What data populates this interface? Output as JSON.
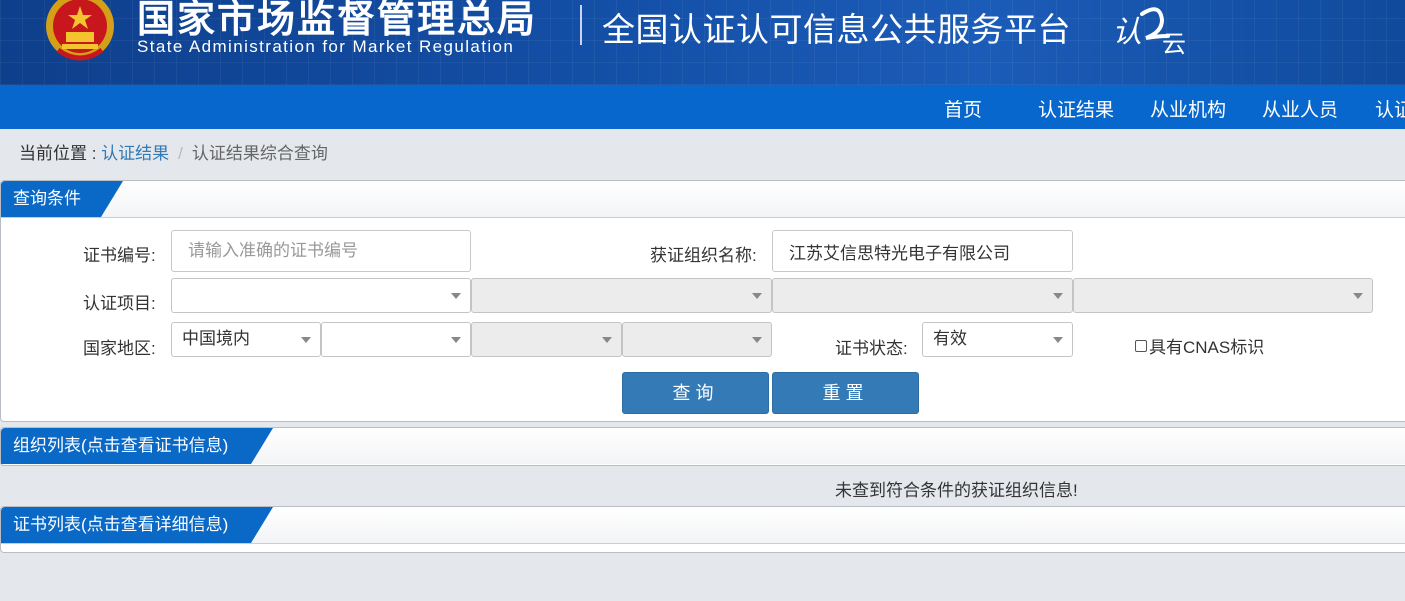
{
  "header": {
    "agency_cn": "国家市场监督管理总局",
    "agency_en": "State Administration  for  Market Regulation",
    "platform_title": "全国认证认可信息公共服务平台",
    "logo_text_1": "认",
    "logo_text_2": "云"
  },
  "nav": {
    "items": [
      "首页",
      "认证结果",
      "从业机构",
      "从业人员",
      "认证"
    ]
  },
  "breadcrumb": {
    "prefix": "当前位置 : ",
    "link": "认证结果",
    "separator": "/",
    "current": "认证结果综合查询"
  },
  "query_panel": {
    "title": "查询条件",
    "cert_no": {
      "label": "证书编号:",
      "placeholder": "请输入准确的证书编号",
      "value": ""
    },
    "org_name": {
      "label": "获证组织名称:",
      "value": "江苏艾信思特光电子有限公司"
    },
    "cert_project": {
      "label": "认证项目:",
      "selects": [
        "",
        "",
        "",
        ""
      ]
    },
    "region": {
      "label": "国家地区:",
      "selects": [
        "中国境内",
        "",
        "",
        ""
      ]
    },
    "cert_status": {
      "label": "证书状态:",
      "value": "有效"
    },
    "cnas": {
      "label": "具有CNAS标识",
      "checked": false
    },
    "buttons": {
      "search": "查询",
      "reset": "重置"
    }
  },
  "org_panel": {
    "title": "组织列表(点击查看证书信息)",
    "empty_message": "未查到符合条件的获证组织信息!"
  },
  "cert_panel": {
    "title": "证书列表(点击查看详细信息)"
  },
  "colors": {
    "banner": "#1450a8",
    "navbar": "#0867cc",
    "tab": "#0a69c6",
    "button": "#337ab7",
    "link": "#337ab7"
  }
}
